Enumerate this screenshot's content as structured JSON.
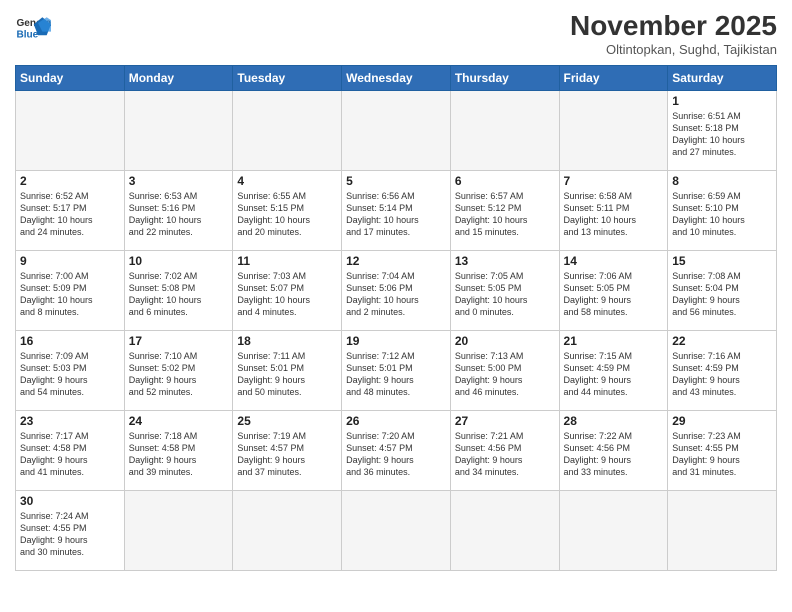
{
  "header": {
    "logo_general": "General",
    "logo_blue": "Blue",
    "month_title": "November 2025",
    "location": "Oltintopkan, Sughd, Tajikistan"
  },
  "weekdays": [
    "Sunday",
    "Monday",
    "Tuesday",
    "Wednesday",
    "Thursday",
    "Friday",
    "Saturday"
  ],
  "weeks": [
    [
      {
        "day": "",
        "info": ""
      },
      {
        "day": "",
        "info": ""
      },
      {
        "day": "",
        "info": ""
      },
      {
        "day": "",
        "info": ""
      },
      {
        "day": "",
        "info": ""
      },
      {
        "day": "",
        "info": ""
      },
      {
        "day": "1",
        "info": "Sunrise: 6:51 AM\nSunset: 5:18 PM\nDaylight: 10 hours\nand 27 minutes."
      }
    ],
    [
      {
        "day": "2",
        "info": "Sunrise: 6:52 AM\nSunset: 5:17 PM\nDaylight: 10 hours\nand 24 minutes."
      },
      {
        "day": "3",
        "info": "Sunrise: 6:53 AM\nSunset: 5:16 PM\nDaylight: 10 hours\nand 22 minutes."
      },
      {
        "day": "4",
        "info": "Sunrise: 6:55 AM\nSunset: 5:15 PM\nDaylight: 10 hours\nand 20 minutes."
      },
      {
        "day": "5",
        "info": "Sunrise: 6:56 AM\nSunset: 5:14 PM\nDaylight: 10 hours\nand 17 minutes."
      },
      {
        "day": "6",
        "info": "Sunrise: 6:57 AM\nSunset: 5:12 PM\nDaylight: 10 hours\nand 15 minutes."
      },
      {
        "day": "7",
        "info": "Sunrise: 6:58 AM\nSunset: 5:11 PM\nDaylight: 10 hours\nand 13 minutes."
      },
      {
        "day": "8",
        "info": "Sunrise: 6:59 AM\nSunset: 5:10 PM\nDaylight: 10 hours\nand 10 minutes."
      }
    ],
    [
      {
        "day": "9",
        "info": "Sunrise: 7:00 AM\nSunset: 5:09 PM\nDaylight: 10 hours\nand 8 minutes."
      },
      {
        "day": "10",
        "info": "Sunrise: 7:02 AM\nSunset: 5:08 PM\nDaylight: 10 hours\nand 6 minutes."
      },
      {
        "day": "11",
        "info": "Sunrise: 7:03 AM\nSunset: 5:07 PM\nDaylight: 10 hours\nand 4 minutes."
      },
      {
        "day": "12",
        "info": "Sunrise: 7:04 AM\nSunset: 5:06 PM\nDaylight: 10 hours\nand 2 minutes."
      },
      {
        "day": "13",
        "info": "Sunrise: 7:05 AM\nSunset: 5:05 PM\nDaylight: 10 hours\nand 0 minutes."
      },
      {
        "day": "14",
        "info": "Sunrise: 7:06 AM\nSunset: 5:05 PM\nDaylight: 9 hours\nand 58 minutes."
      },
      {
        "day": "15",
        "info": "Sunrise: 7:08 AM\nSunset: 5:04 PM\nDaylight: 9 hours\nand 56 minutes."
      }
    ],
    [
      {
        "day": "16",
        "info": "Sunrise: 7:09 AM\nSunset: 5:03 PM\nDaylight: 9 hours\nand 54 minutes."
      },
      {
        "day": "17",
        "info": "Sunrise: 7:10 AM\nSunset: 5:02 PM\nDaylight: 9 hours\nand 52 minutes."
      },
      {
        "day": "18",
        "info": "Sunrise: 7:11 AM\nSunset: 5:01 PM\nDaylight: 9 hours\nand 50 minutes."
      },
      {
        "day": "19",
        "info": "Sunrise: 7:12 AM\nSunset: 5:01 PM\nDaylight: 9 hours\nand 48 minutes."
      },
      {
        "day": "20",
        "info": "Sunrise: 7:13 AM\nSunset: 5:00 PM\nDaylight: 9 hours\nand 46 minutes."
      },
      {
        "day": "21",
        "info": "Sunrise: 7:15 AM\nSunset: 4:59 PM\nDaylight: 9 hours\nand 44 minutes."
      },
      {
        "day": "22",
        "info": "Sunrise: 7:16 AM\nSunset: 4:59 PM\nDaylight: 9 hours\nand 43 minutes."
      }
    ],
    [
      {
        "day": "23",
        "info": "Sunrise: 7:17 AM\nSunset: 4:58 PM\nDaylight: 9 hours\nand 41 minutes."
      },
      {
        "day": "24",
        "info": "Sunrise: 7:18 AM\nSunset: 4:58 PM\nDaylight: 9 hours\nand 39 minutes."
      },
      {
        "day": "25",
        "info": "Sunrise: 7:19 AM\nSunset: 4:57 PM\nDaylight: 9 hours\nand 37 minutes."
      },
      {
        "day": "26",
        "info": "Sunrise: 7:20 AM\nSunset: 4:57 PM\nDaylight: 9 hours\nand 36 minutes."
      },
      {
        "day": "27",
        "info": "Sunrise: 7:21 AM\nSunset: 4:56 PM\nDaylight: 9 hours\nand 34 minutes."
      },
      {
        "day": "28",
        "info": "Sunrise: 7:22 AM\nSunset: 4:56 PM\nDaylight: 9 hours\nand 33 minutes."
      },
      {
        "day": "29",
        "info": "Sunrise: 7:23 AM\nSunset: 4:55 PM\nDaylight: 9 hours\nand 31 minutes."
      }
    ],
    [
      {
        "day": "30",
        "info": "Sunrise: 7:24 AM\nSunset: 4:55 PM\nDaylight: 9 hours\nand 30 minutes."
      },
      {
        "day": "",
        "info": ""
      },
      {
        "day": "",
        "info": ""
      },
      {
        "day": "",
        "info": ""
      },
      {
        "day": "",
        "info": ""
      },
      {
        "day": "",
        "info": ""
      },
      {
        "day": "",
        "info": ""
      }
    ]
  ]
}
